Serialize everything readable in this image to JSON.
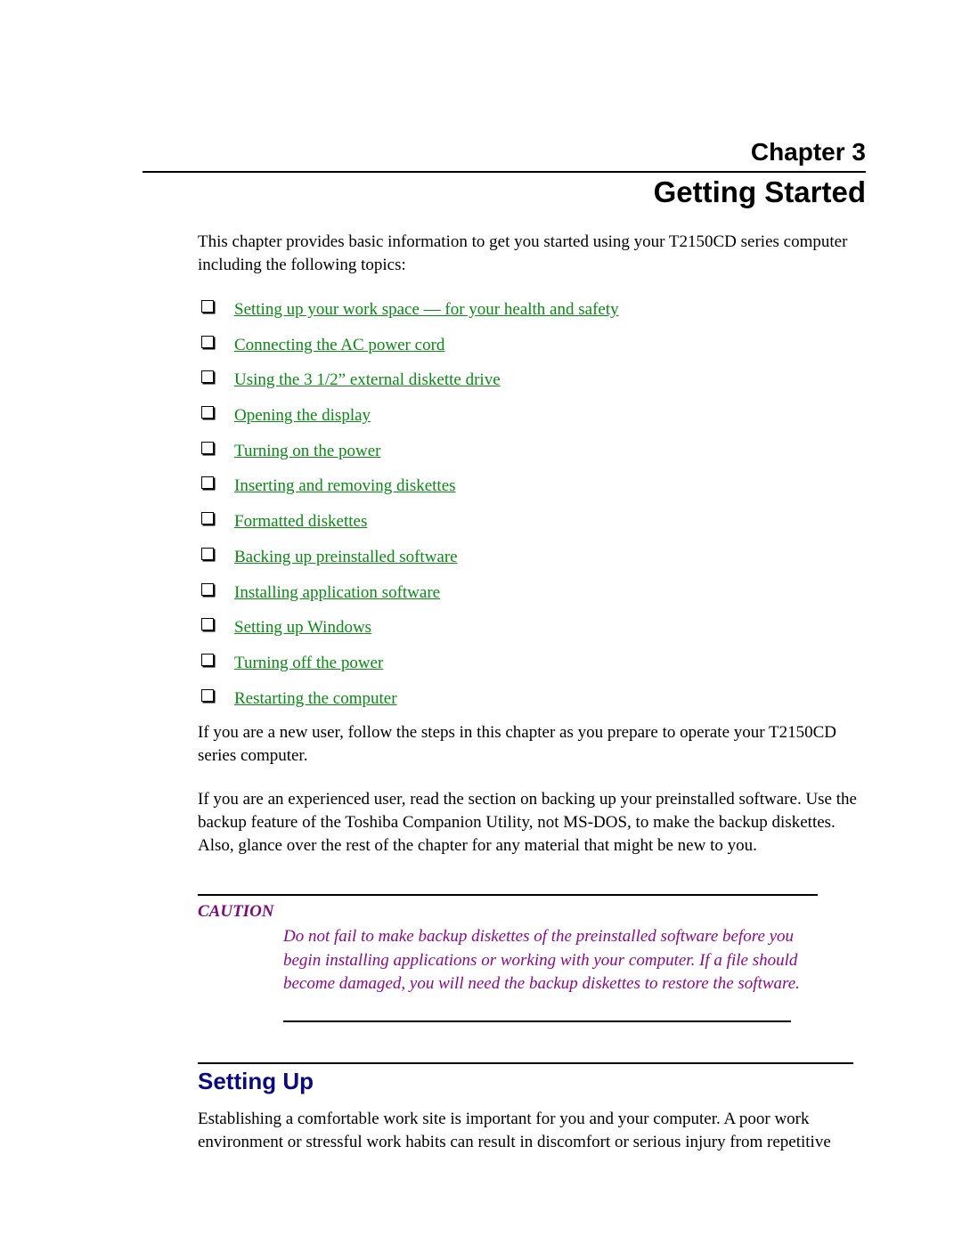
{
  "header": {
    "chapter_label": "Chapter 3",
    "chapter_title": "Getting Started"
  },
  "intro": "This chapter provides basic information to get you started using your T2150CD series computer including the following topics:",
  "topics": [
    {
      "label": "Setting up your work space — for your health and safety"
    },
    {
      "label": "Connecting the AC power cord"
    },
    {
      "label": "Using the 3 1/2” external diskette drive"
    },
    {
      "label": "Opening the display"
    },
    {
      "label": "Turning on the power"
    },
    {
      "label": "Inserting and removing diskettes"
    },
    {
      "label": "Formatted diskettes"
    },
    {
      "label": "Backing up preinstalled software"
    },
    {
      "label": "Installing application software"
    },
    {
      "label": "Setting up Windows"
    },
    {
      "label": "Turning off the power"
    },
    {
      "label": "Restarting the computer"
    }
  ],
  "new_user_text": "If you are a new user, follow the steps in this chapter as you prepare to operate your T2150CD series computer.",
  "experienced_text": "If you are an experienced user, read the section on backing up your preinstalled software. Use the backup feature of the Toshiba Companion Utility, not MS-DOS, to make the backup diskettes. Also, glance over the rest of the chapter for any material that might be new to you.",
  "caution": {
    "label": "CAUTION",
    "text": "Do not fail to make backup diskettes of the preinstalled software before you begin installing applications or working with your computer. If a file should become damaged, you will need the backup diskettes to restore the software."
  },
  "section": {
    "title": "Setting Up",
    "text": "Establishing a comfortable work site is important for you and your computer. A poor work environment or stressful work habits can result in discomfort or serious injury from repetitive"
  },
  "colors": {
    "link": "#0a8a14",
    "caution": "#8a0a8a",
    "section_heading": "#0a0a80"
  }
}
